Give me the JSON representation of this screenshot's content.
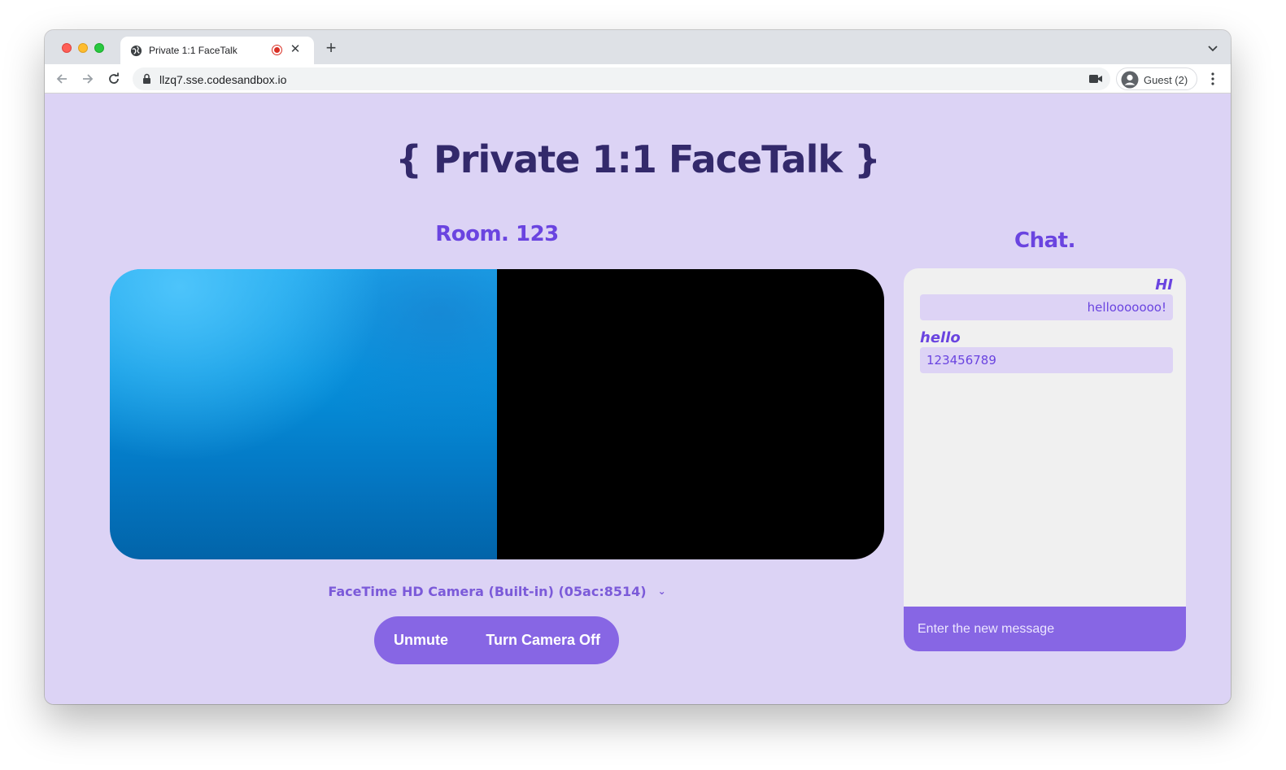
{
  "browser": {
    "tab_title": "Private 1:1 FaceTalk",
    "url": "llzq7.sse.codesandbox.io",
    "profile_label": "Guest (2)"
  },
  "page": {
    "title": "{ Private 1:1 FaceTalk }",
    "room_title": "Room. 123",
    "camera_select": "FaceTime HD Camera (Built-in) (05ac:8514)",
    "controls": {
      "unmute_label": "Unmute",
      "camera_label": "Turn Camera Off"
    }
  },
  "chat": {
    "title": "Chat.",
    "messages": [
      {
        "author": "HI",
        "text": "hellooooooo!",
        "align": "right"
      },
      {
        "author": "hello",
        "text": "123456789",
        "align": "left"
      }
    ],
    "input_placeholder": "Enter the new message"
  },
  "colors": {
    "page_bg": "#dcd3f5",
    "accent": "#6a44e0",
    "button": "#8766e4",
    "title": "#33296b"
  }
}
